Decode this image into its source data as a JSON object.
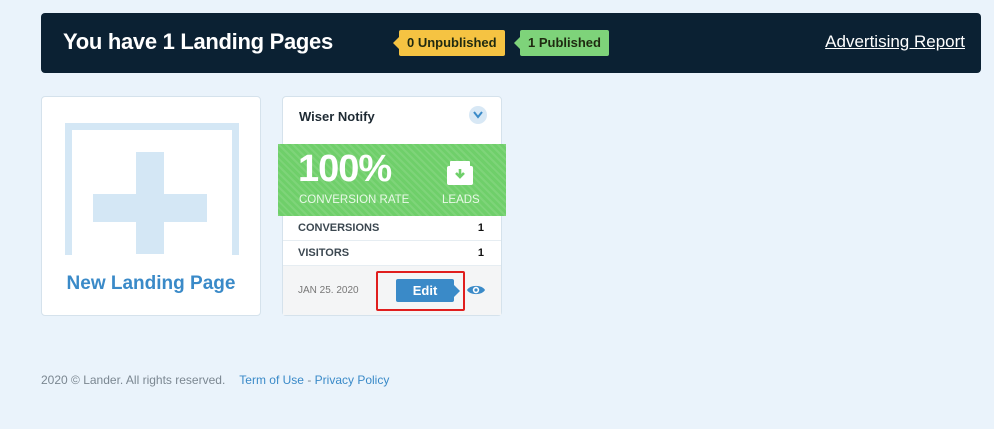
{
  "header": {
    "title": "You have 1 Landing Pages",
    "unpublished_badge": "0 Unpublished",
    "published_badge": "1 Published",
    "report_link": "Advertising Report"
  },
  "new_page": {
    "label": "New Landing Page"
  },
  "landing_page": {
    "name": "Wiser Notify",
    "conversion_rate_value": "100%",
    "conversion_rate_label": "CONVERSION RATE",
    "leads_label": "LEADS",
    "stats": [
      {
        "label": "CONVERSIONS",
        "value": "1"
      },
      {
        "label": "VISITORS",
        "value": "1"
      }
    ],
    "date": "JAN 25. 2020",
    "edit_label": "Edit"
  },
  "footer": {
    "copyright": "2020 © Lander. All rights reserved.",
    "terms": "Term of Use",
    "separator": " - ",
    "privacy": "Privacy Policy"
  },
  "colors": {
    "header_bg": "#0b2133",
    "accent_blue": "#3a8ac8",
    "conversion_green": "#6fcf6a",
    "unpublished_yellow": "#f5c342",
    "published_green": "#7ed37a",
    "highlight_red": "#e01e1e"
  },
  "icons": [
    "chevron-down-icon",
    "leads-inbox-icon",
    "eye-icon",
    "plus-icon"
  ]
}
